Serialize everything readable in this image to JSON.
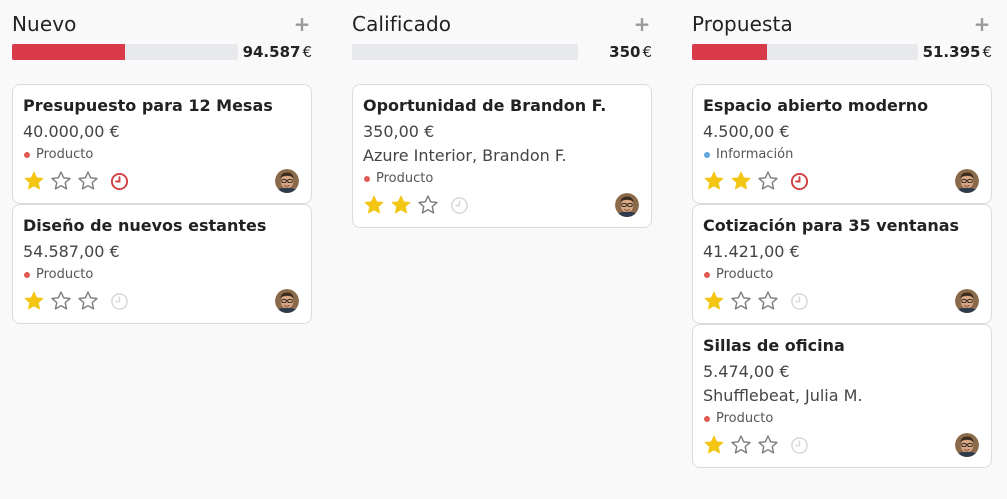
{
  "columns": [
    {
      "title": "Nuevo",
      "total": "94.587",
      "currency": "€",
      "progress": 0.5,
      "cards": [
        {
          "title": "Presupuesto para 12 Mesas",
          "amount": "40.000,00 €",
          "partner": "",
          "tag": "Producto",
          "tag_color": "#e05a55",
          "stars": 1,
          "activity": "overdue"
        },
        {
          "title": "Diseño de nuevos estantes",
          "amount": "54.587,00 €",
          "partner": "",
          "tag": "Producto",
          "tag_color": "#e05a55",
          "stars": 1,
          "activity": "none"
        }
      ]
    },
    {
      "title": "Calificado",
      "total": "350",
      "currency": "€",
      "progress": 0,
      "cards": [
        {
          "title": "Oportunidad de Brandon F.",
          "amount": "350,00 €",
          "partner": "Azure Interior, Brandon F.",
          "tag": "Producto",
          "tag_color": "#e05a55",
          "stars": 2,
          "activity": "none"
        }
      ]
    },
    {
      "title": "Propuesta",
      "total": "51.395",
      "currency": "€",
      "progress": 0.33,
      "cards": [
        {
          "title": "Espacio abierto moderno",
          "amount": "4.500,00 €",
          "partner": "",
          "tag": "Información",
          "tag_color": "#5fa8e0",
          "stars": 2,
          "activity": "overdue"
        },
        {
          "title": "Cotización para 35 ventanas",
          "amount": "41.421,00 €",
          "partner": "",
          "tag": "Producto",
          "tag_color": "#e05a55",
          "stars": 1,
          "activity": "none"
        },
        {
          "title": "Sillas de oficina",
          "amount": "5.474,00 €",
          "partner": "Shufflebeat, Julia M.",
          "tag": "Producto",
          "tag_color": "#e05a55",
          "stars": 1,
          "activity": "none"
        }
      ]
    }
  ],
  "icons": {
    "add": "plus-icon",
    "star": "star-icon",
    "activity": "clock-icon",
    "avatar": "user-avatar"
  },
  "colors": {
    "progress_fill": "#d93a4a",
    "star_filled": "#f3c614",
    "star_empty": "#7a7a7a",
    "clock_overdue": "#d23f3f",
    "clock_none": "#d8d8d8"
  }
}
